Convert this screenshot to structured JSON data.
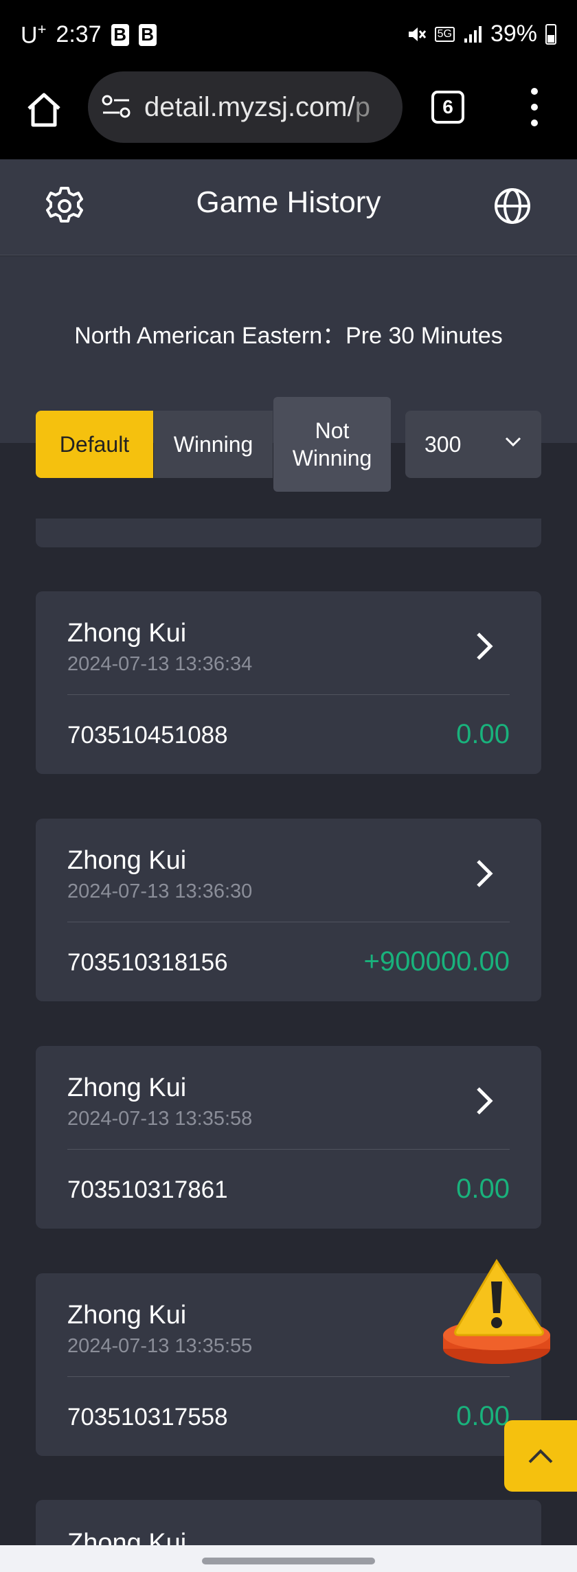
{
  "status_bar": {
    "carrier": "U",
    "carrier_sup": "+",
    "time": "2:37",
    "b1": "B",
    "b2": "B",
    "network": "5G",
    "battery": "39%"
  },
  "browser": {
    "url": "detail.myzsj.com/",
    "url_faded": "p",
    "tab_count": "6"
  },
  "header": {
    "title": "Game History"
  },
  "filters": {
    "timezone_text": "North American Eastern：Pre 30 Minutes",
    "default_label": "Default",
    "winning_label": "Winning",
    "not_winning_line1": "Not",
    "not_winning_line2": "Winning",
    "count_value": "300"
  },
  "records": [
    {
      "game": "Zhong Kui",
      "time": "2024-07-13 13:36:34",
      "order": "703510451088",
      "amount": "0.00"
    },
    {
      "game": "Zhong Kui",
      "time": "2024-07-13 13:36:30",
      "order": "703510318156",
      "amount": "+900000.00"
    },
    {
      "game": "Zhong Kui",
      "time": "2024-07-13 13:35:58",
      "order": "703510317861",
      "amount": "0.00"
    },
    {
      "game": "Zhong Kui",
      "time": "2024-07-13 13:35:55",
      "order": "703510317558",
      "amount": "0.00"
    }
  ],
  "partial_record": {
    "game": "Zhong Kui"
  },
  "colors": {
    "accent": "#f5c10e",
    "positive": "#19b27c",
    "card": "#353844",
    "background": "#262831"
  }
}
